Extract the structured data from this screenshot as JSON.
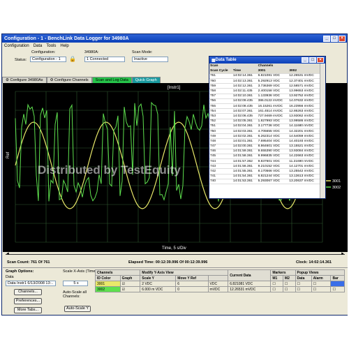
{
  "window": {
    "title": "Configuration - 1 - BenchLink Data Logger for 34980A",
    "menu": [
      "Configuration",
      "Data",
      "Tools",
      "Help"
    ]
  },
  "info": {
    "configuration_label": "Configuration:",
    "configuration_value": "Configuration - 1",
    "instrument_label": "34980A:",
    "instrument_value": "1 Connected",
    "scan_mode_label": "Scan Mode:",
    "scan_mode_value": "Inactive"
  },
  "tabs": [
    "Configure 34980As",
    "Configure Channels",
    "Scan and Log Data",
    "Quick Graph"
  ],
  "graph": {
    "instrument_label": "[Instr1]",
    "y_axis_label": "Ref",
    "x_axis_label": "Time, 5 s/Div",
    "watermark": "Distributed by TestEquity",
    "legend": [
      "3001",
      "3002"
    ],
    "colors": {
      "ch3001": "#e8e86a",
      "ch3002": "#5ee04e",
      "grid": "#2e5a2e"
    }
  },
  "scan_status": {
    "scan_count": "Scan Count: 761 Of 761",
    "elapsed": "Elapsed Time: 00:12:39.996 Of 00:12:39.996",
    "clock": "Clock: 14:02:14.361"
  },
  "graph_options": {
    "title": "Graph Options:",
    "data_label": "Data",
    "data_value": "Data Instr1 6/13/2008 13:..",
    "channels_button": "Channels...",
    "preferences_button": "Preferences...",
    "more_tabs_button": "More Tabs...",
    "scale_x_label": "Scale X-Axis (Time):",
    "scale_x_value": "5 s",
    "autoscale_label": "Auto-Scale all Channels:",
    "autoscale_button": "Auto-Scale Y"
  },
  "channels_table": {
    "group_channels": "Channels",
    "group_modify": "Modify Y-Axis View",
    "group_current": "Current Data",
    "group_markers": "Markers",
    "group_popup": "Popup Views",
    "headers": [
      "ID Color",
      "Graph",
      "Scale Y",
      "Move Y Ref",
      "",
      "M1",
      "M2",
      "Data",
      "Alarm",
      "Bar"
    ],
    "rows": [
      {
        "id": "3001",
        "color": "#e8e86a",
        "scale_y": "2",
        "scale_unit": "VDC",
        "move_ref": "6",
        "move_unit": "VDC",
        "current": "6.821081 VDC"
      },
      {
        "id": "3002",
        "color": "#5ee04e",
        "scale_y": "6.000",
        "scale_unit": "m VDC",
        "move_ref": "0",
        "move_unit": "mVDC",
        "current": "12.26531 mVDC"
      }
    ]
  },
  "data_table": {
    "title": "Data Table",
    "header_scan": "Scan",
    "header_channels": "Channels",
    "header_scan_cycle": "Scan Cycle",
    "header_time": "Time",
    "header_ch1": "3001",
    "header_ch2": "3002",
    "rows": [
      [
        "761",
        "14:02:14.361",
        "6.821081 VDC",
        "12.26531 mVDC"
      ],
      [
        "760",
        "14:02:13.361",
        "5.292913 VDC",
        "12.37401 mVDC"
      ],
      [
        "759",
        "14:02:12.361",
        "3.736369 VDC",
        "12.58571 mVDC"
      ],
      [
        "758",
        "14:02:11.435",
        "2.400158 VDC",
        "13.99653 mVDC"
      ],
      [
        "757",
        "14:02:10.361",
        "1.133936 VDC",
        "13.92752 mVDC"
      ],
      [
        "756",
        "14:02:09.435",
        "386.0122 mVDC",
        "14.07632 mVDC"
      ],
      [
        "755",
        "14:02:08.435",
        "16.15261 mVDC",
        "16.23956 mVDC"
      ],
      [
        "754",
        "14:02:07.361",
        "161.4514 mVDC",
        "12.86263 mVDC"
      ],
      [
        "753",
        "14:02:06.435",
        "727.9469 mVDC",
        "13.93062 mVDC"
      ],
      [
        "752",
        "14:02:05.361",
        "1.827993 VDC",
        "13.99586 mVDC"
      ],
      [
        "751",
        "14:02:04.361",
        "3.177736 VDC",
        "14.11680 mVDC"
      ],
      [
        "750",
        "14:02:03.361",
        "4.705655 VDC",
        "14.32201 mVDC"
      ],
      [
        "749",
        "14:02:02.361",
        "6.262314 VDC",
        "14.54059 mVDC"
      ],
      [
        "748",
        "14:02:01.361",
        "7.695404 VDC",
        "14.40193 mVDC"
      ],
      [
        "747",
        "14:02:00.361",
        "8.864601 VDC",
        "13.15521 mVDC"
      ],
      [
        "746",
        "14:01:59.361",
        "9.655390 VDC",
        "13.93084 mVDC"
      ],
      [
        "745",
        "14:01:58.361",
        "9.996835 VDC",
        "14.22663 mVDC"
      ],
      [
        "744",
        "14:01:57.362",
        "9.837601 VDC",
        "11.21690 mVDC"
      ],
      [
        "743",
        "14:01:56.361",
        "9.210152 VDC",
        "14.12701 mVDC"
      ],
      [
        "742",
        "14:01:55.361",
        "8.170566 VDC",
        "13.25542 mVDC"
      ],
      [
        "741",
        "14:01:54.361",
        "6.821244 VDC",
        "13.13613 mVDC"
      ],
      [
        "740",
        "14:01:53.361",
        "5.293067 VDC",
        "13.20637 mVDC"
      ]
    ]
  }
}
